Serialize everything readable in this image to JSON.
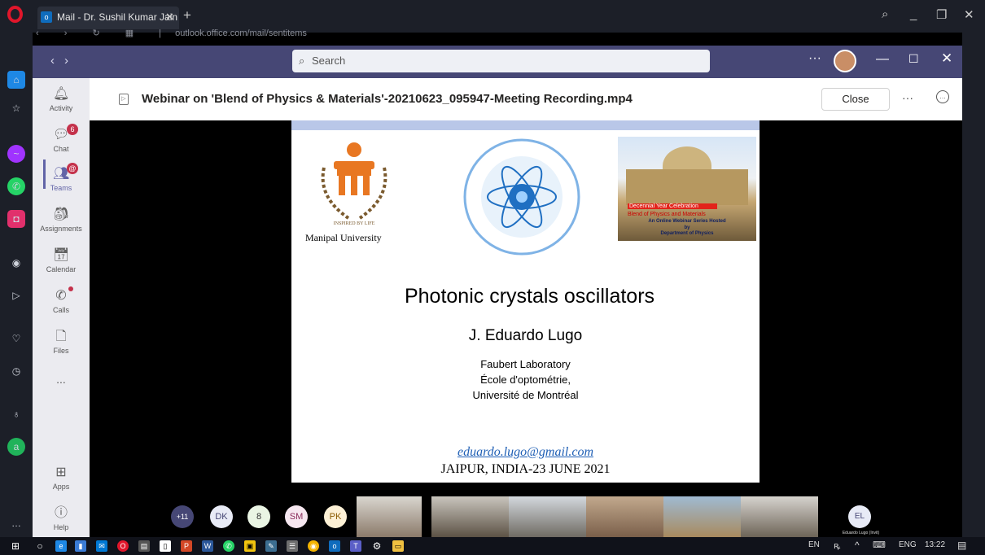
{
  "browser": {
    "tab_title": "Mail - Dr. Sushil Kumar Jain",
    "url": "outlook.office.com/mail/sentitems"
  },
  "teams": {
    "search_placeholder": "Search",
    "rail": [
      {
        "label": "Activity"
      },
      {
        "label": "Chat",
        "badge": "6"
      },
      {
        "label": "Teams",
        "badge": "@"
      },
      {
        "label": "Assignments"
      },
      {
        "label": "Calendar"
      },
      {
        "label": "Calls"
      },
      {
        "label": "Files"
      },
      {
        "label": "..."
      },
      {
        "label": "Apps"
      },
      {
        "label": "Help"
      }
    ]
  },
  "recording": {
    "title": "Webinar on 'Blend of Physics & Materials'-20210623_095947-Meeting Recording.mp4",
    "close_label": "Close"
  },
  "slide": {
    "university": "Manipal University",
    "poster": {
      "line1": "Decennial Year Celebration",
      "line2": "Blend of Physics and Materials",
      "line3": "An Online Webinar Series Hosted",
      "line4": "by",
      "line5": "Department of Physics"
    },
    "title": "Photonic crystals oscillators",
    "author": "J. Eduardo Lugo",
    "affiliation": [
      "Faubert Laboratory",
      "École d'optométrie,",
      "Université de Montréal"
    ],
    "email": "eduardo.lugo@gmail.com",
    "place_date": "JAIPUR, INDIA-23 JUNE  2021"
  },
  "participants": {
    "more": "+11",
    "initials": [
      "DK",
      "8",
      "SM",
      "PK"
    ],
    "el_initials": "EL",
    "el_name": "Eduardo Lugo (Invit)"
  },
  "taskbar": {
    "lang": "EN",
    "input": "ENG",
    "time": "13:22"
  },
  "colors": {
    "teams_purple": "#464775",
    "badge_red": "#c4314b",
    "opera_red": "#e0162b"
  }
}
